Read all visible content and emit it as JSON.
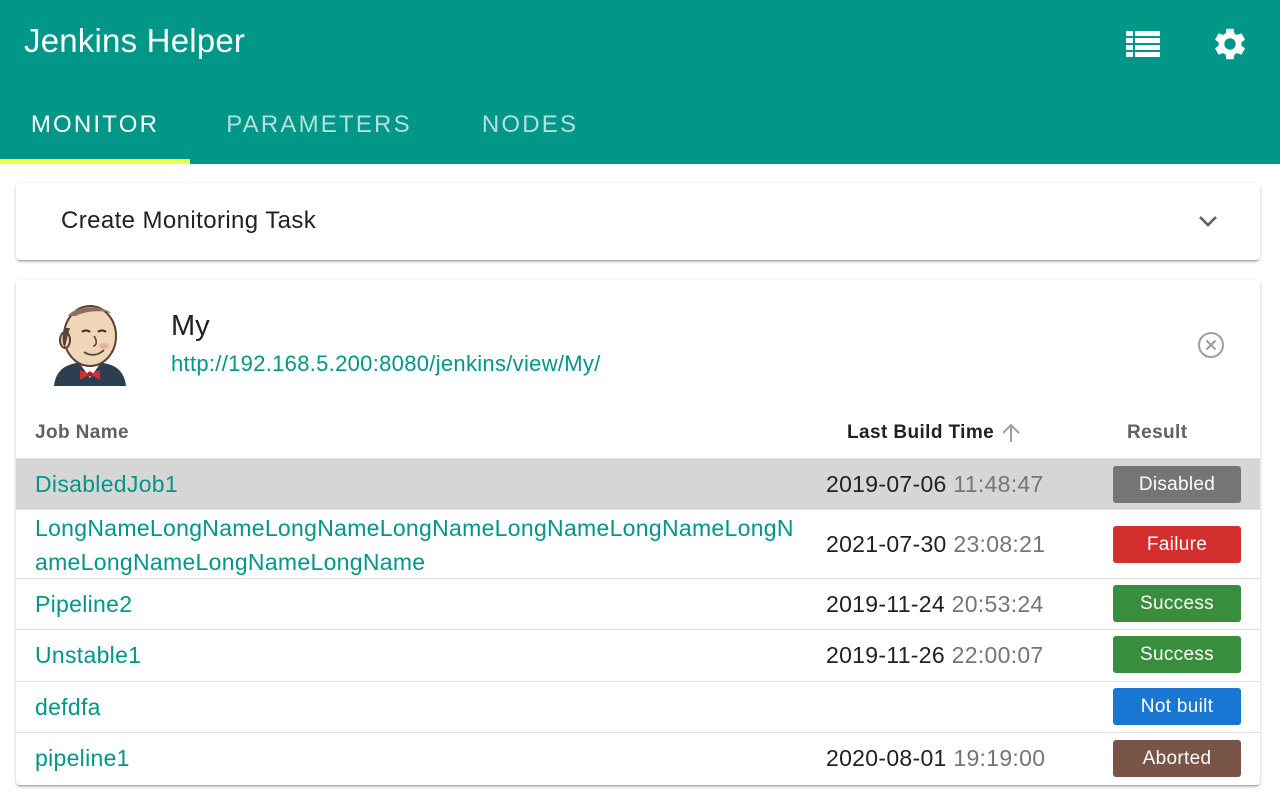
{
  "app": {
    "title": "Jenkins Helper",
    "icons": {
      "list": "view-list-icon",
      "settings": "gear-icon"
    }
  },
  "tabs": [
    {
      "label": "MONITOR",
      "active": true
    },
    {
      "label": "PARAMETERS",
      "active": false
    },
    {
      "label": "NODES",
      "active": false
    }
  ],
  "create_panel": {
    "title": "Create Monitoring Task",
    "expanded": false
  },
  "monitor": {
    "view_name": "My",
    "url": "http://192.168.5.200:8080/jenkins/view/My/",
    "table": {
      "headers": {
        "job_name": "Job Name",
        "last_build_time": "Last Build Time",
        "result": "Result"
      },
      "sort": {
        "column": "last_build_time",
        "direction": "ascending"
      },
      "rows": [
        {
          "name": "DisabledJob1",
          "date": "2019-07-06",
          "time": "11:48:47",
          "result": "Disabled",
          "color": "#757575",
          "highlighted": true
        },
        {
          "name": "LongNameLongNameLongNameLongNameLongNameLongNameLongNameLongNameLongNameLongName",
          "date": "2021-07-30",
          "time": "23:08:21",
          "result": "Failure",
          "color": "#d32f2f",
          "highlighted": false
        },
        {
          "name": "Pipeline2",
          "date": "2019-11-24",
          "time": "20:53:24",
          "result": "Success",
          "color": "#388e3c",
          "highlighted": false
        },
        {
          "name": "Unstable1",
          "date": "2019-11-26",
          "time": "22:00:07",
          "result": "Success",
          "color": "#388e3c",
          "highlighted": false
        },
        {
          "name": "defdfa",
          "date": "",
          "time": "",
          "result": "Not built",
          "color": "#1976d2",
          "highlighted": false
        },
        {
          "name": "pipeline1",
          "date": "2020-08-01",
          "time": "19:19:00",
          "result": "Aborted",
          "color": "#795548",
          "highlighted": false
        }
      ]
    }
  }
}
